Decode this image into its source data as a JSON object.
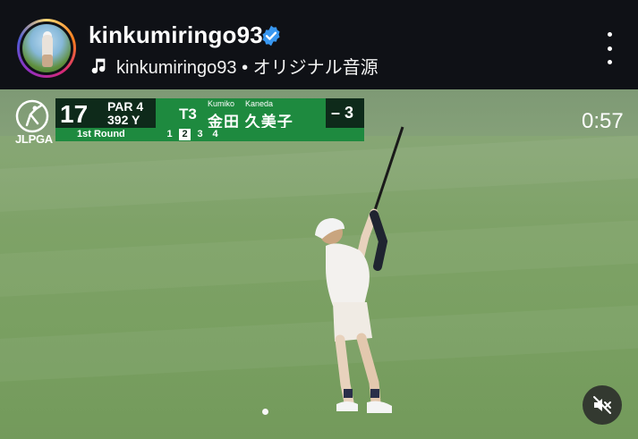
{
  "header": {
    "username": "kinkumiringo93",
    "verified_icon": "verified-badge-icon",
    "audio_icon": "music-note-icon",
    "audio_text": "kinkumiringo93 • オリジナル音源",
    "more_icon": "more-vertical-icon"
  },
  "video": {
    "timer": "0:57",
    "logo_text": "JLPGA",
    "mute_icon": "volume-off-icon",
    "scorebug": {
      "hole": "17",
      "par": "PAR 4",
      "yards": "392 Y",
      "position": "T3",
      "name_romaji_first": "Kumiko",
      "name_romaji_last": "Kaneda",
      "name_kanji": "金田 久美子",
      "score": "– 3",
      "round": "1st Round",
      "rounds": [
        "1",
        "2",
        "3",
        "4"
      ],
      "active_round": "2"
    }
  },
  "colors": {
    "header_bg": "#0f1116",
    "scorebug_dark": "#0e2a1a",
    "scorebug_green": "#1e8a3f",
    "verified": "#3897f0"
  }
}
